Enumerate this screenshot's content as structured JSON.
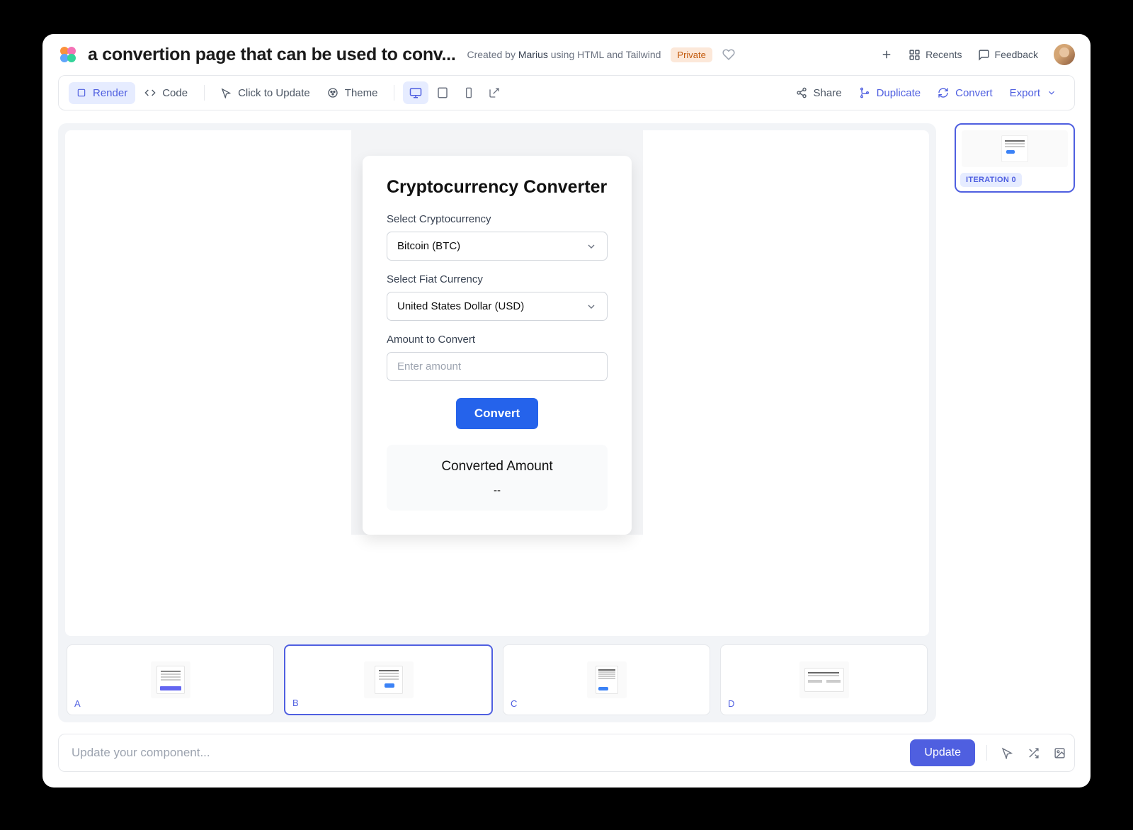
{
  "header": {
    "title": "a convertion page that can be used to conv...",
    "createdByPrefix": "Created by ",
    "author": "Marius",
    "createdBySuffix": " using HTML and Tailwind",
    "privacyBadge": "Private",
    "recents": "Recents",
    "feedback": "Feedback"
  },
  "toolbar": {
    "render": "Render",
    "code": "Code",
    "clickToUpdate": "Click to Update",
    "theme": "Theme",
    "share": "Share",
    "duplicate": "Duplicate",
    "convert": "Convert",
    "export": "Export"
  },
  "converter": {
    "title": "Cryptocurrency Converter",
    "cryptoLabel": "Select Cryptocurrency",
    "cryptoValue": "Bitcoin (BTC)",
    "fiatLabel": "Select Fiat Currency",
    "fiatValue": "United States Dollar (USD)",
    "amountLabel": "Amount to Convert",
    "amountPlaceholder": "Enter amount",
    "convertBtn": "Convert",
    "resultTitle": "Converted Amount",
    "resultValue": "--"
  },
  "iterations": {
    "label": "ITERATION 0"
  },
  "variants": {
    "a": "A",
    "b": "B",
    "c": "C",
    "d": "D"
  },
  "bottomBar": {
    "placeholder": "Update your component...",
    "updateBtn": "Update"
  }
}
